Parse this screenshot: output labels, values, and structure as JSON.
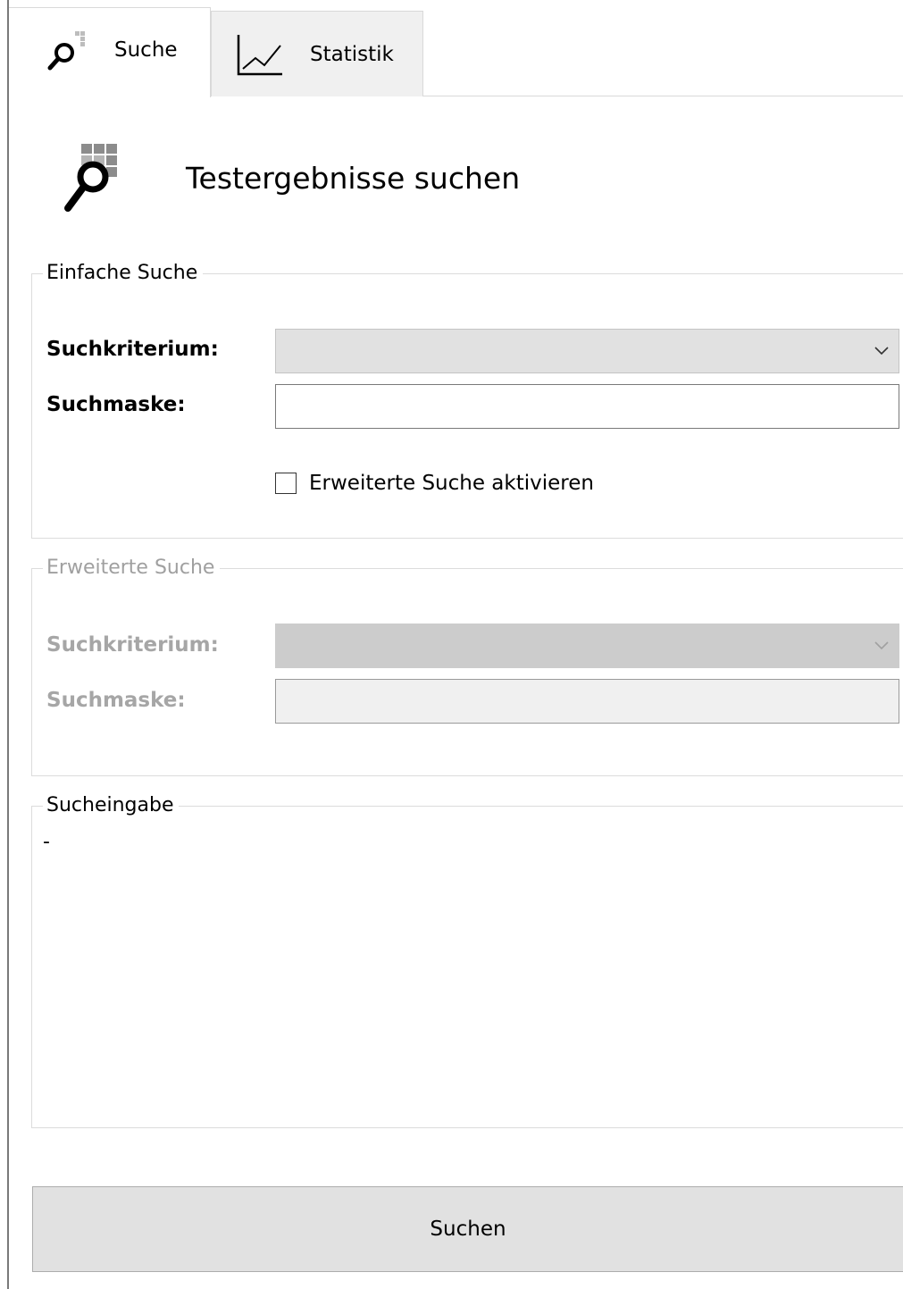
{
  "tabs": [
    {
      "label": "Suche",
      "icon": "search-grid-icon",
      "selected": true
    },
    {
      "label": "Statistik",
      "icon": "line-chart-icon",
      "selected": false
    }
  ],
  "header": {
    "title": "Testergebnisse suchen",
    "icon": "search-grid-icon"
  },
  "simple_search": {
    "legend": "Einfache Suche",
    "criterion_label": "Suchkriterium:",
    "criterion_value": "",
    "mask_label": "Suchmaske:",
    "mask_value": "",
    "advanced_checkbox_label": "Erweiterte Suche aktivieren",
    "advanced_checked": false
  },
  "advanced_search": {
    "legend": "Erweiterte Suche",
    "enabled": false,
    "criterion_label": "Suchkriterium:",
    "criterion_value": "",
    "mask_label": "Suchmaske:",
    "mask_value": ""
  },
  "search_input": {
    "legend": "Sucheingabe",
    "text": "-"
  },
  "actions": {
    "search_label": "Suchen"
  },
  "colors": {
    "combo_bg": "#e1e1e1",
    "disabled_text": "#a6a6a6",
    "button_bg": "#e1e1e1"
  }
}
